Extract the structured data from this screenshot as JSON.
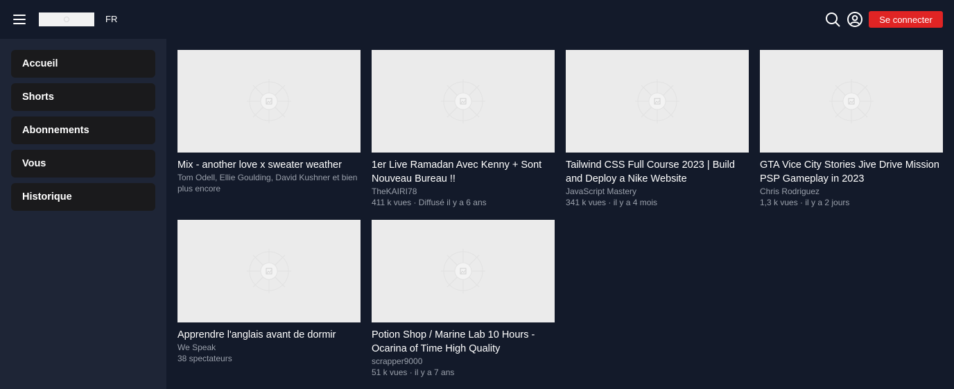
{
  "header": {
    "lang": "FR",
    "login_label": "Se connecter",
    "accent_color": "#e02424"
  },
  "sidebar": {
    "items": [
      {
        "label": "Accueil"
      },
      {
        "label": "Shorts"
      },
      {
        "label": "Abonnements"
      },
      {
        "label": "Vous"
      },
      {
        "label": "Historique"
      }
    ]
  },
  "videos": [
    {
      "title": "Mix - another love x sweater weather",
      "channel": "Tom Odell, Ellie Goulding, David Kushner et bien plus encore",
      "meta": ""
    },
    {
      "title": "1er Live Ramadan Avec Kenny + Sont Nouveau Bureau !!",
      "channel": "TheKAIRI78",
      "meta": "411 k vues · Diffusé il y a 6 ans"
    },
    {
      "title": "Tailwind CSS Full Course 2023 | Build and Deploy a Nike Website",
      "channel": "JavaScript Mastery",
      "meta": "341 k vues · il y a 4 mois"
    },
    {
      "title": "GTA Vice City Stories Jive Drive Mission PSP Gameplay in 2023",
      "channel": "Chris Rodriguez",
      "meta": "1,3 k vues · il y a 2 jours"
    },
    {
      "title": "Apprendre l'anglais avant de dormir",
      "channel": "We Speak",
      "meta": "38 spectateurs"
    },
    {
      "title": "Potion Shop / Marine Lab 10 Hours - Ocarina of Time High Quality",
      "channel": "scrapper9000",
      "meta": "51 k vues · il y a 7 ans"
    }
  ]
}
